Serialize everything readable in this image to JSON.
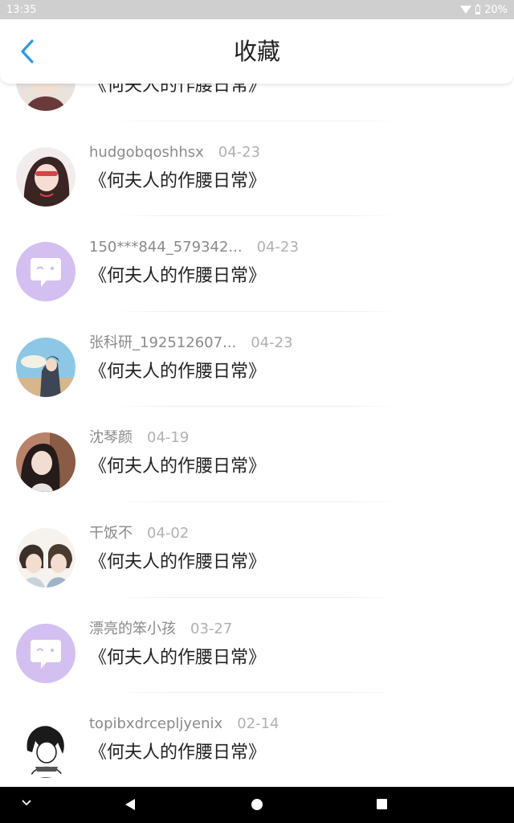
{
  "status_bar": {
    "time": "13:35",
    "battery": "20%"
  },
  "header": {
    "title": "收藏"
  },
  "items": [
    {
      "user": "",
      "date": "",
      "title": "《何夫人的作腰日常》"
    },
    {
      "user": "hudgobqoshhsx",
      "date": "04-23",
      "title": "《何夫人的作腰日常》"
    },
    {
      "user": "150***844_579342...",
      "date": "04-23",
      "title": "《何夫人的作腰日常》"
    },
    {
      "user": "张科研_192512607...",
      "date": "04-23",
      "title": "《何夫人的作腰日常》"
    },
    {
      "user": "沈琴颜",
      "date": "04-19",
      "title": "《何夫人的作腰日常》"
    },
    {
      "user": "干饭不",
      "date": "04-02",
      "title": "《何夫人的作腰日常》"
    },
    {
      "user": "漂亮的笨小孩",
      "date": "03-27",
      "title": "《何夫人的作腰日常》"
    },
    {
      "user": "topibxdrcepljyenix",
      "date": "02-14",
      "title": "《何夫人的作腰日常》"
    }
  ],
  "colors": {
    "accent": "#2a9ae6",
    "default_avatar": "#d3bff0"
  }
}
